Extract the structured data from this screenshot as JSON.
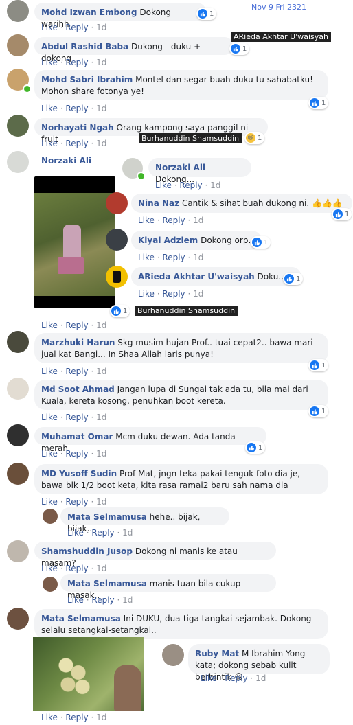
{
  "timestamp_overlay": "Nov 9 Fri 2321",
  "actions": {
    "like": "Like",
    "reply": "Reply",
    "sep": "·"
  },
  "overlay_labels": {
    "arieda": "ARieda Akhtar U'waisyah",
    "burhan1": "Burhanuddin Shamsuddin",
    "burhan2": "Burhanuddin Shamsuddin"
  },
  "comments": [
    {
      "name": "Mohd Izwan Embong",
      "text": "Dokong warihh",
      "time": "1d",
      "reactions": "1"
    },
    {
      "name": "Abdul Rashid Baba",
      "text": "Dukong - duku + dokong",
      "time": "1d",
      "reactions": "1"
    },
    {
      "name": "Mohd Sabri Ibrahim",
      "text": "Montel dan segar buah duku tu sahabatku! Mohon share fotonya ye!",
      "time": "1d",
      "reactions": "1"
    },
    {
      "name": "Norhayati Ngah",
      "text": "Orang kampong saya panggil ni fruit",
      "time": "1d",
      "reactions": "1"
    },
    {
      "name": "Norzaki Ali",
      "time": "1d",
      "reactions": "1"
    },
    {
      "name": "Marzhuki Harun",
      "text": "Skg musim hujan Prof.. tuai cepat2.. bawa mari jual kat Bangi... In Shaa Allah laris punya!",
      "time": "1d",
      "reactions": "1"
    },
    {
      "name": "Md Soot Ahmad",
      "text": "Jangan lupa di Sungai tak ada tu, bila mai dari Kuala, kereta kosong, penuhkan boot kereta.",
      "time": "1d",
      "reactions": "1"
    },
    {
      "name": "Muhamat Omar",
      "text": "Mcm duku dewan. Ada tanda merah",
      "time": "1d",
      "reactions": "1"
    },
    {
      "name": "MD Yusoff Sudin",
      "text": "Prof Mat, jngn teka pakai tenguk foto dia je, bawa blk 1/2 boot keta, kita rasa ramai2 baru sah nama dia",
      "time": "1d"
    },
    {
      "name": "Shamshuddin Jusop",
      "text": "Dokong ni manis ke atau masam?",
      "time": "1d"
    },
    {
      "name": "Mata Selmamusa",
      "text": "Ini DUKU, dua-tiga tangkai sejambak. Dokong selalu setangkai-setangkai..",
      "time": "1d"
    }
  ],
  "replies": {
    "norzaki_reply": {
      "name": "Norzaki Ali",
      "text": "Dokong...",
      "time": "1d"
    },
    "nina": {
      "name": "Nina Naz",
      "text": "Cantik & sihat buah dukong ni.",
      "emoji": "👍👍👍",
      "time": "1d",
      "reactions": "1"
    },
    "kiyai": {
      "name": "Kiyai Adziem",
      "text": "Dokong orp..",
      "time": "1d",
      "reactions": "1"
    },
    "arieda": {
      "name": "ARieda Akhtar U'waisyah",
      "text": "Doku....",
      "time": "1d",
      "reactions": "1"
    },
    "mata1": {
      "name": "Mata Selmamusa",
      "text": "hehe.. bijak, bijak..",
      "time": "1d"
    },
    "mata2": {
      "name": "Mata Selmamusa",
      "text": "manis tuan bila cukup masak..",
      "time": "1d"
    },
    "ruby": {
      "name": "Ruby Mat",
      "text": "M Ibrahim Yong kata; dokong sebab kulit berbintik",
      "emoji": "😆",
      "time": "1d"
    }
  },
  "colors": {
    "link": "#385898",
    "bubble": "#f2f3f5",
    "like_blue": "#1877f2",
    "online": "#42b72a"
  }
}
